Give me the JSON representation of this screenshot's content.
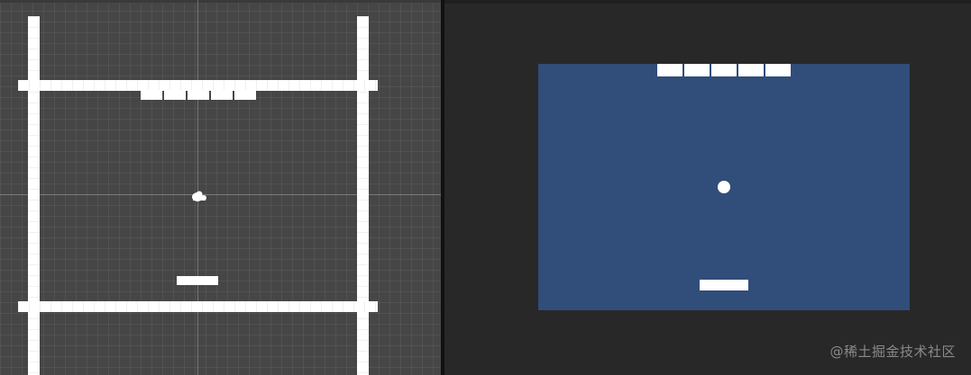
{
  "scene_view": {
    "brick_count": 5,
    "ball_icon": "scene-sprite-gizmo-icon",
    "background_color": "#464646",
    "object_color": "#ffffff"
  },
  "game_view": {
    "brick_count": 5,
    "canvas_color": "#314d79",
    "background_color": "#282828",
    "object_color": "#ffffff"
  },
  "watermark": "@稀土掘金技术社区"
}
